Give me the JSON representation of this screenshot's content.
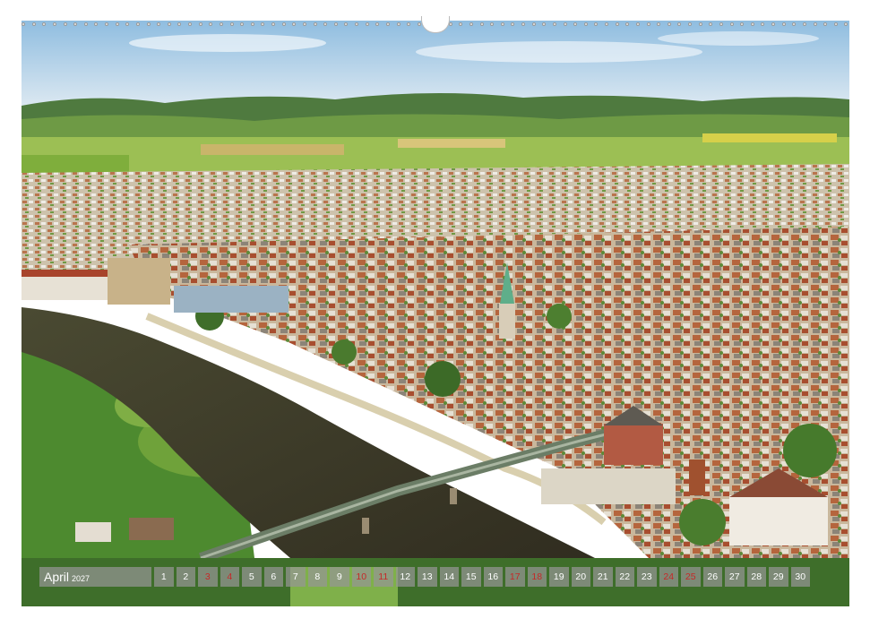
{
  "calendar": {
    "month": "April",
    "year": "2027",
    "days": [
      {
        "n": "1",
        "red": false
      },
      {
        "n": "2",
        "red": false
      },
      {
        "n": "3",
        "red": true
      },
      {
        "n": "4",
        "red": true
      },
      {
        "n": "5",
        "red": false
      },
      {
        "n": "6",
        "red": false
      },
      {
        "n": "7",
        "red": false
      },
      {
        "n": "8",
        "red": false
      },
      {
        "n": "9",
        "red": false
      },
      {
        "n": "10",
        "red": true
      },
      {
        "n": "11",
        "red": true
      },
      {
        "n": "12",
        "red": false
      },
      {
        "n": "13",
        "red": false
      },
      {
        "n": "14",
        "red": false
      },
      {
        "n": "15",
        "red": false
      },
      {
        "n": "16",
        "red": false
      },
      {
        "n": "17",
        "red": true
      },
      {
        "n": "18",
        "red": true
      },
      {
        "n": "19",
        "red": false
      },
      {
        "n": "20",
        "red": false
      },
      {
        "n": "21",
        "red": false
      },
      {
        "n": "22",
        "red": false
      },
      {
        "n": "23",
        "red": false
      },
      {
        "n": "24",
        "red": true
      },
      {
        "n": "25",
        "red": true
      },
      {
        "n": "26",
        "red": false
      },
      {
        "n": "27",
        "red": false
      },
      {
        "n": "28",
        "red": false
      },
      {
        "n": "29",
        "red": false
      },
      {
        "n": "30",
        "red": false
      }
    ]
  },
  "colors": {
    "weekend": "#c62828",
    "day_box": "#969696",
    "day_text": "#ffffff"
  }
}
